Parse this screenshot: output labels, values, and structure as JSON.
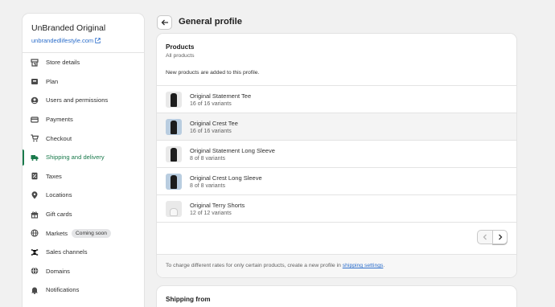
{
  "store": {
    "name": "UnBranded Original",
    "domain": "unbrandedlifestyle.com"
  },
  "nav": [
    {
      "label": "Store details",
      "icon": "store-icon"
    },
    {
      "label": "Plan",
      "icon": "plan-icon"
    },
    {
      "label": "Users and permissions",
      "icon": "user-icon"
    },
    {
      "label": "Payments",
      "icon": "payments-icon"
    },
    {
      "label": "Checkout",
      "icon": "cart-icon"
    },
    {
      "label": "Shipping and delivery",
      "icon": "truck-icon",
      "active": true
    },
    {
      "label": "Taxes",
      "icon": "taxes-icon"
    },
    {
      "label": "Locations",
      "icon": "location-pin-icon"
    },
    {
      "label": "Gift cards",
      "icon": "gift-icon"
    },
    {
      "label": "Markets",
      "icon": "globe-icon",
      "badge": "Coming soon"
    },
    {
      "label": "Sales channels",
      "icon": "sales-channels-icon"
    },
    {
      "label": "Domains",
      "icon": "domain-globe-icon"
    },
    {
      "label": "Notifications",
      "icon": "bell-icon"
    }
  ],
  "page": {
    "title": "General profile"
  },
  "products": {
    "title": "Products",
    "subtitle": "All products",
    "note": "New products are added to this profile.",
    "items": [
      {
        "name": "Original Statement Tee",
        "variants": "16 of 16 variants"
      },
      {
        "name": "Original Crest Tee",
        "variants": "16 of 16 variants"
      },
      {
        "name": "Original Statement Long Sleeve",
        "variants": "8 of 8 variants"
      },
      {
        "name": "Original Crest Long Sleeve",
        "variants": "8 of 8 variants"
      },
      {
        "name": "Original Terry Shorts",
        "variants": "12 of 12 variants"
      }
    ],
    "footer_text": "To charge different rates for only certain products, create a new profile in ",
    "footer_link": "shipping settings",
    "footer_end": "."
  },
  "shipping_from": {
    "title": "Shipping from"
  },
  "colors": {
    "accent": "#1a7a4c",
    "link": "#2c6ecb"
  }
}
